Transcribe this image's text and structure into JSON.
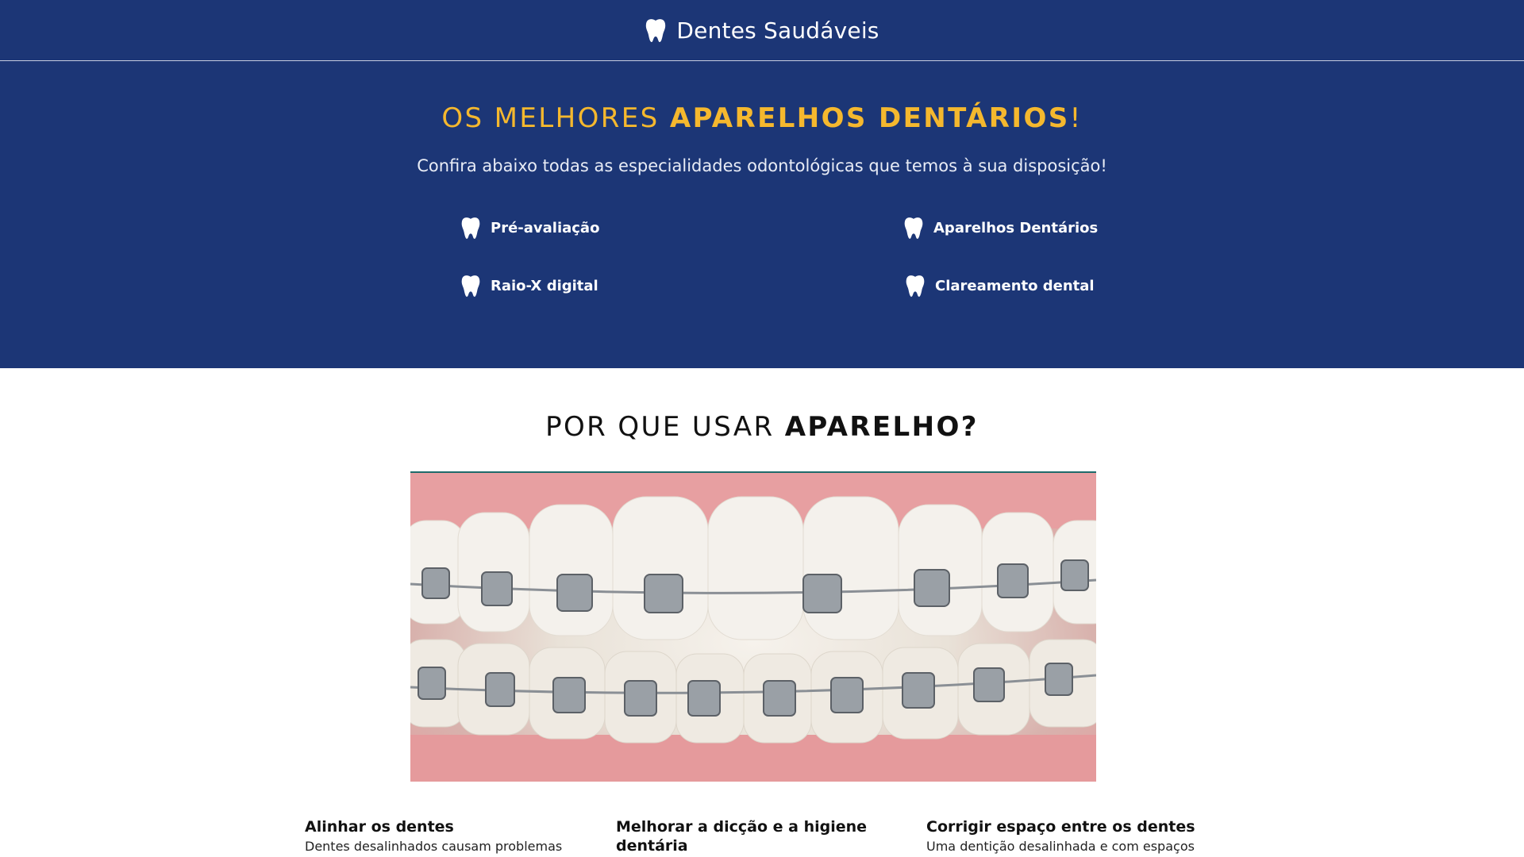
{
  "header": {
    "brand_name": "Dentes Saudáveis",
    "brand_icon": "tooth-icon"
  },
  "hero": {
    "title_light": "OS MELHORES ",
    "title_strong": "APARELHOS DENTÁRIOS",
    "title_end": "!",
    "subtitle": "Confira abaixo todas as especialidades odontológicas que temos à sua disposição!",
    "features": [
      {
        "label": "Pré-avaliação",
        "icon": "tooth-icon"
      },
      {
        "label": "Aparelhos Dentários",
        "icon": "tooth-icon"
      },
      {
        "label": "Raio-X digital",
        "icon": "tooth-icon"
      },
      {
        "label": "Clareamento dental",
        "icon": "tooth-icon"
      }
    ]
  },
  "why": {
    "title_light": "POR QUE USAR ",
    "title_strong": "APARELHO?",
    "columns": [
      {
        "title": "Alinhar os dentes",
        "text": "Dentes desalinhados causam problemas"
      },
      {
        "title": "Melhorar a dicção e a higiene dentária",
        "text": ""
      },
      {
        "title": "Corrigir espaço entre os dentes",
        "text": "Uma dentição desalinhada e com espaços"
      }
    ]
  },
  "colors": {
    "navy": "#1c3676",
    "accent_gold": "#f5b82e",
    "white": "#ffffff"
  }
}
